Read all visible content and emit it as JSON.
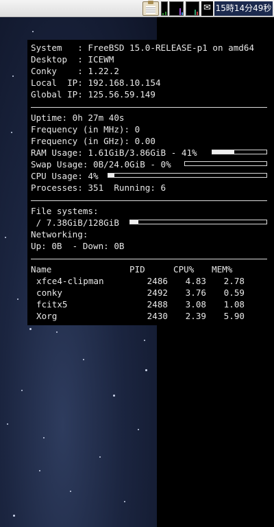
{
  "taskbar": {
    "clock": "15時14分49秒",
    "icons": [
      "clipboard-icon",
      "cpu-meter",
      "network-meter",
      "memory-meter",
      "mail-icon"
    ],
    "mail_glyph": "✉"
  },
  "colors": {
    "conky_bg": "#000000",
    "conky_text": "#e8e8e8",
    "clock_bg": "#1c2a4e",
    "taskbar_bg": "#e8e8e8",
    "wallpaper": "#1b2540"
  },
  "conky": {
    "system": {
      "lines": [
        "System   : FreeBSD 15.0-RELEASE-p1 on amd64",
        "Desktop  : ICEWM",
        "Conky    : 1.22.2",
        "Local  IP: 192.168.10.154",
        "Global IP: 125.56.59.149"
      ]
    },
    "stats": {
      "uptime": "Uptime: 0h 27m 40s",
      "freq_mhz": "Frequency (in MHz): 0",
      "freq_ghz": "Frequency (in GHz): 0.00",
      "ram": "RAM Usage: 1.61GiB/3.86GiB - 41%",
      "ram_percent": 41,
      "swap": "Swap Usage: 0B/24.0GiB - 0%",
      "swap_percent": 0,
      "cpu": "CPU Usage: 4%",
      "cpu_percent": 4,
      "processes": "Processes: 351  Running: 6"
    },
    "fs": {
      "header": "File systems:",
      "root": " / 7.38GiB/128GiB",
      "root_percent": 6,
      "net_header": "Networking:",
      "net": "Up: 0B  - Down: 0B"
    },
    "procs": {
      "headers": {
        "name": "Name",
        "pid": "PID",
        "cpu": "CPU%",
        "mem": "MEM%"
      },
      "rows": [
        {
          "name": "xfce4-clipman",
          "pid": "2486",
          "cpu": "4.83",
          "mem": "2.78"
        },
        {
          "name": "conky",
          "pid": "2492",
          "cpu": "3.76",
          "mem": "0.59"
        },
        {
          "name": "fcitx5",
          "pid": "2488",
          "cpu": "3.08",
          "mem": "1.08"
        },
        {
          "name": "Xorg",
          "pid": "2430",
          "cpu": "2.39",
          "mem": "5.90"
        }
      ]
    }
  }
}
